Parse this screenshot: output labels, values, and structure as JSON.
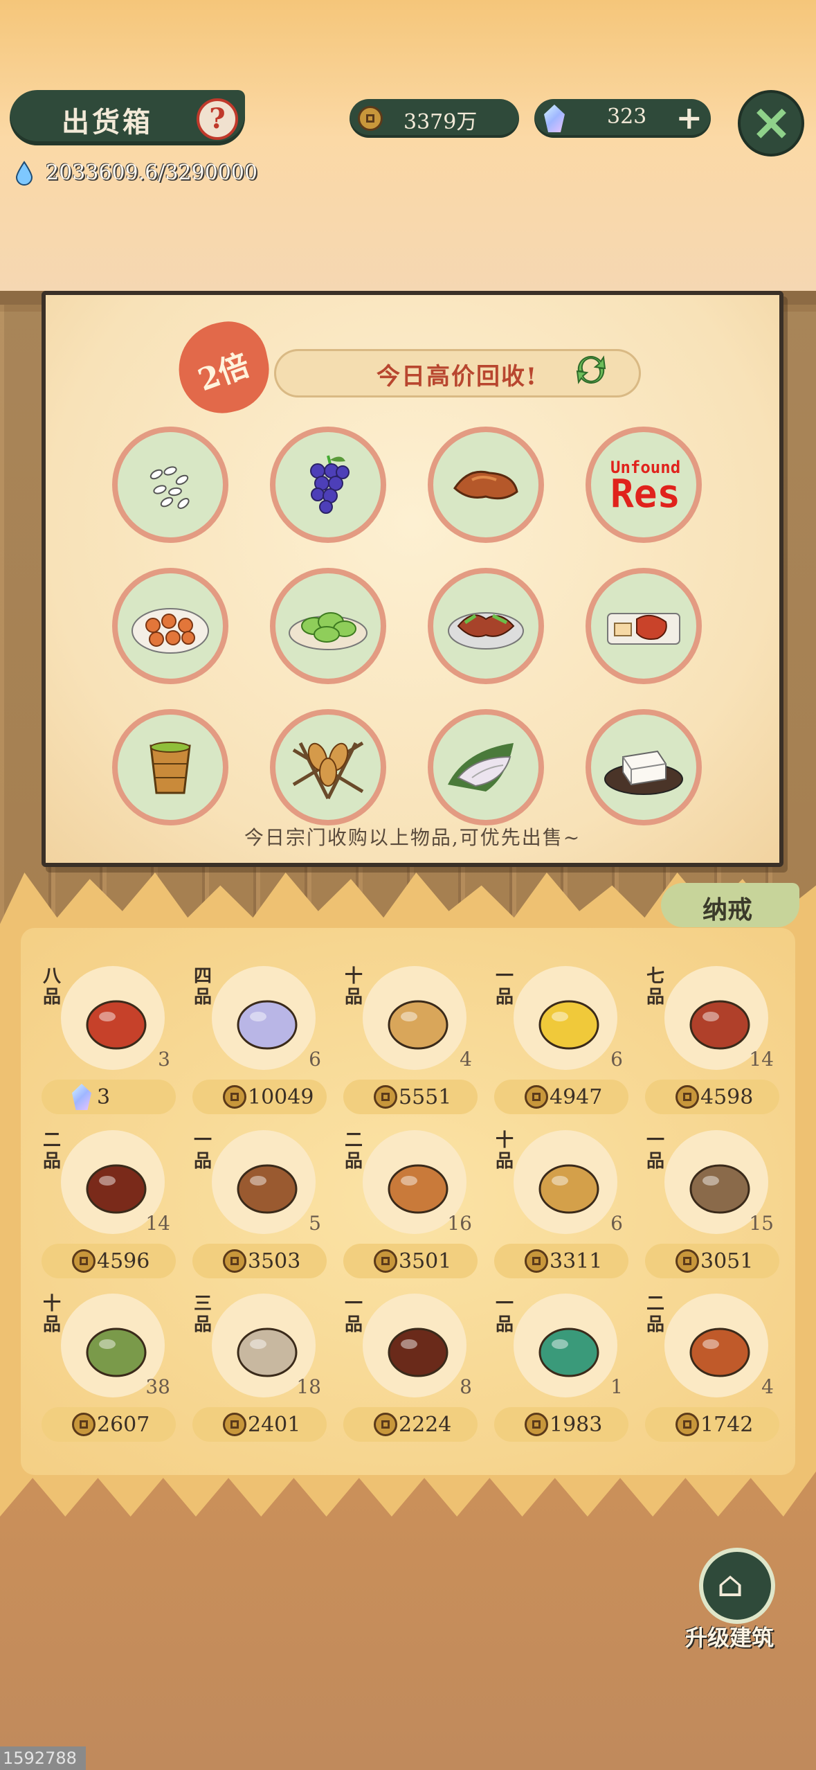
{
  "header": {
    "title": "出货箱",
    "help_icon": "question-icon",
    "energy": "2033609.6/3290000",
    "coins": "3379万",
    "gems": "323",
    "add_label": "+",
    "close_label": "✕"
  },
  "board": {
    "multiplier": "2倍",
    "banner": "今日高价回收!",
    "footer": "今日宗门收购以上物品,可优先出售~",
    "missing_texture_line1": "Unfound",
    "missing_texture_line2": "Res",
    "slots": [
      {
        "icon": "rice-grains-icon"
      },
      {
        "icon": "grapes-icon"
      },
      {
        "icon": "roasted-meat-icon"
      },
      {
        "icon": "missing-texture-icon"
      },
      {
        "icon": "dumplings-plate-icon"
      },
      {
        "icon": "vegetable-dish-icon"
      },
      {
        "icon": "stir-fry-dish-icon"
      },
      {
        "icon": "roast-duck-icon"
      },
      {
        "icon": "green-tea-cup-icon"
      },
      {
        "icon": "grilled-skewers-icon"
      },
      {
        "icon": "fish-fillet-icon"
      },
      {
        "icon": "tofu-icon"
      }
    ]
  },
  "inventory": {
    "tab_label": "纳戒",
    "items": [
      {
        "grade": "八品",
        "qty": "3",
        "price": "3",
        "currency": "gem",
        "icon": "red-berries-icon"
      },
      {
        "grade": "四品",
        "qty": "6",
        "price": "10049",
        "currency": "coin",
        "icon": "robe-icon"
      },
      {
        "grade": "十品",
        "qty": "4",
        "price": "5551",
        "currency": "coin",
        "icon": "nuts-platter-icon"
      },
      {
        "grade": "一品",
        "qty": "6",
        "price": "4947",
        "currency": "coin",
        "icon": "golden-artifact-icon"
      },
      {
        "grade": "七品",
        "qty": "14",
        "price": "4598",
        "currency": "coin",
        "icon": "red-cloth-icon"
      },
      {
        "grade": "二品",
        "qty": "14",
        "price": "4596",
        "currency": "coin",
        "icon": "chili-dish-icon"
      },
      {
        "grade": "一品",
        "qty": "5",
        "price": "3503",
        "currency": "coin",
        "icon": "figurine-icon"
      },
      {
        "grade": "二品",
        "qty": "16",
        "price": "3501",
        "currency": "coin",
        "icon": "fried-fish-box-icon"
      },
      {
        "grade": "十品",
        "qty": "6",
        "price": "3311",
        "currency": "coin",
        "icon": "gourd-icon"
      },
      {
        "grade": "一品",
        "qty": "15",
        "price": "3051",
        "currency": "coin",
        "icon": "clay-pot-icon"
      },
      {
        "grade": "十品",
        "qty": "38",
        "price": "2607",
        "currency": "coin",
        "icon": "herb-plate-icon"
      },
      {
        "grade": "三品",
        "qty": "18",
        "price": "2401",
        "currency": "coin",
        "icon": "clay-jug-icon"
      },
      {
        "grade": "一品",
        "qty": "8",
        "price": "2224",
        "currency": "coin",
        "icon": "wine-jar-icon"
      },
      {
        "grade": "一品",
        "qty": "1",
        "price": "1983",
        "currency": "coin",
        "icon": "feather-icon"
      },
      {
        "grade": "二品",
        "qty": "4",
        "price": "1742",
        "currency": "coin",
        "icon": "hotpot-icon"
      }
    ]
  },
  "footer": {
    "upgrade_label": "升级建筑",
    "build_id": "1592788"
  }
}
